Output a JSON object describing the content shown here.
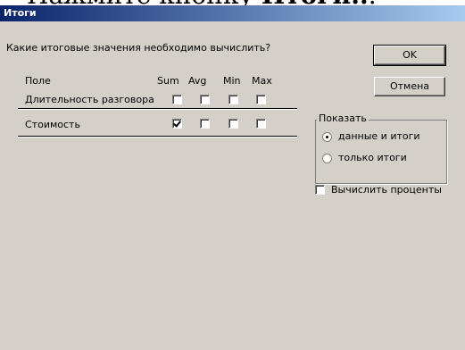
{
  "top_caption": {
    "prefix": "Нажмите кнопку ",
    "bold": "Итоги..",
    "suffix": "."
  },
  "window": {
    "title": "Итоги"
  },
  "prompt": "Какие итоговые значения необходимо вычислить?",
  "table": {
    "header": {
      "field": "Поле",
      "columns": [
        "Sum",
        "Avg",
        "Min",
        "Max"
      ]
    },
    "rows": [
      {
        "name": "Длительность разговора",
        "checks": [
          false,
          false,
          false,
          false
        ]
      },
      {
        "name": "Стоимость",
        "checks": [
          true,
          false,
          false,
          false
        ]
      }
    ]
  },
  "buttons": {
    "ok": "OK",
    "cancel": "Отмена"
  },
  "show_group": {
    "title": "Показать",
    "options": [
      {
        "label": "данные и итоги",
        "selected": true
      },
      {
        "label": "только итоги",
        "selected": false
      }
    ]
  },
  "percent_checkbox": {
    "label": "Вычислить проценты",
    "checked": false
  }
}
